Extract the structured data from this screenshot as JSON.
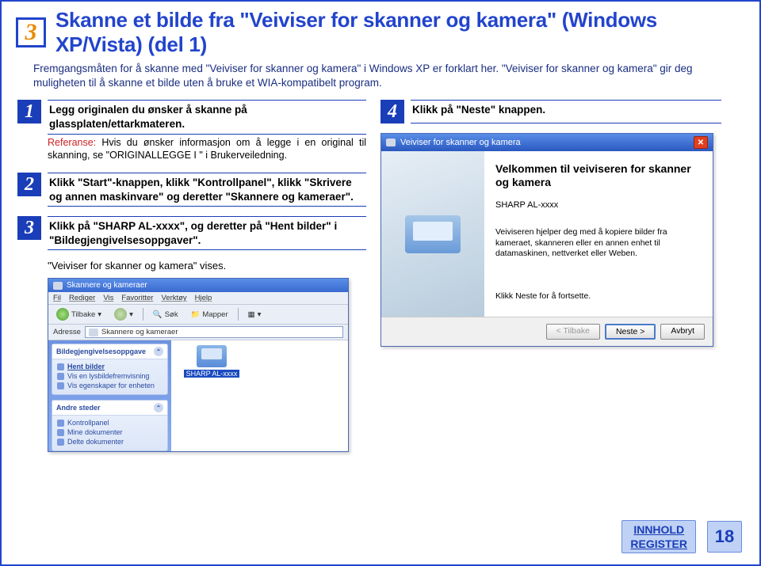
{
  "section_number": "3",
  "title": "Skanne et bilde fra \"Veiviser for skanner og kamera\" (Windows XP/Vista) (del 1)",
  "intro": "Fremgangsmåten for å skanne med \"Veiviser for skanner og kamera\" i Windows XP er forklart her. \"Veiviser for skanner og kamera\" gir deg muligheten til å skanne et bilde uten å bruke et WIA-kompatibelt program.",
  "steps": {
    "s1": {
      "num": "1",
      "text": "Legg originalen du ønsker å skanne på glassplaten/ettarkmateren."
    },
    "s1_ref_label": "Referanse:",
    "s1_ref_text": " Hvis du ønsker informasjon om å legge i en original til skanning, se \"ORIGINALLEGGE I \" i Brukerveiledning.",
    "s2": {
      "num": "2",
      "text": "Klikk \"Start\"-knappen, klikk \"Kontrollpanel\", klikk \"Skrivere og annen maskinvare\" og deretter \"Skannere og kameraer\"."
    },
    "s3": {
      "num": "3",
      "text": "Klikk på \"SHARP AL-xxxx\", og deretter på \"Hent bilder\" i \"Bildegjengivelsesoppgaver\"."
    },
    "s3_note": "\"Veiviser for skanner og kamera\" vises.",
    "s4": {
      "num": "4",
      "text": "Klikk på \"Neste\" knappen."
    }
  },
  "explorer": {
    "title": "Skannere og kameraer",
    "menu": [
      "Fil",
      "Rediger",
      "Vis",
      "Favoritter",
      "Verktøy",
      "Hjelp"
    ],
    "tb_back": "Tilbake",
    "tb_search": "Søk",
    "tb_folders": "Mapper",
    "addr_label": "Adresse",
    "addr_value": "Skannere og kameraer",
    "panel1_title": "Bildegjengivelsesoppgave",
    "panel1_items": [
      "Hent bilder",
      "Vis en lysbildefremvisning",
      "Vis egenskaper for enheten"
    ],
    "panel2_title": "Andre steder",
    "panel2_items": [
      "Kontrollpanel",
      "Mine dokumenter",
      "Delte dokumenter"
    ],
    "device_label": "SHARP AL-xxxx"
  },
  "wizard": {
    "title": "Veiviser for skanner og kamera",
    "heading": "Velkommen til veiviseren for skanner og kamera",
    "sub": "SHARP AL-xxxx",
    "desc": "Veiviseren hjelper deg med å kopiere bilder fra kameraet, skanneren eller en annen enhet til datamaskinen, nettverket eller Weben.",
    "foot": "Klikk Neste for å fortsette.",
    "btn_back": "< Tilbake",
    "btn_next": "Neste >",
    "btn_cancel": "Avbryt"
  },
  "nav": {
    "innhold": "INNHOLD",
    "register": "REGISTER",
    "page": "18"
  }
}
